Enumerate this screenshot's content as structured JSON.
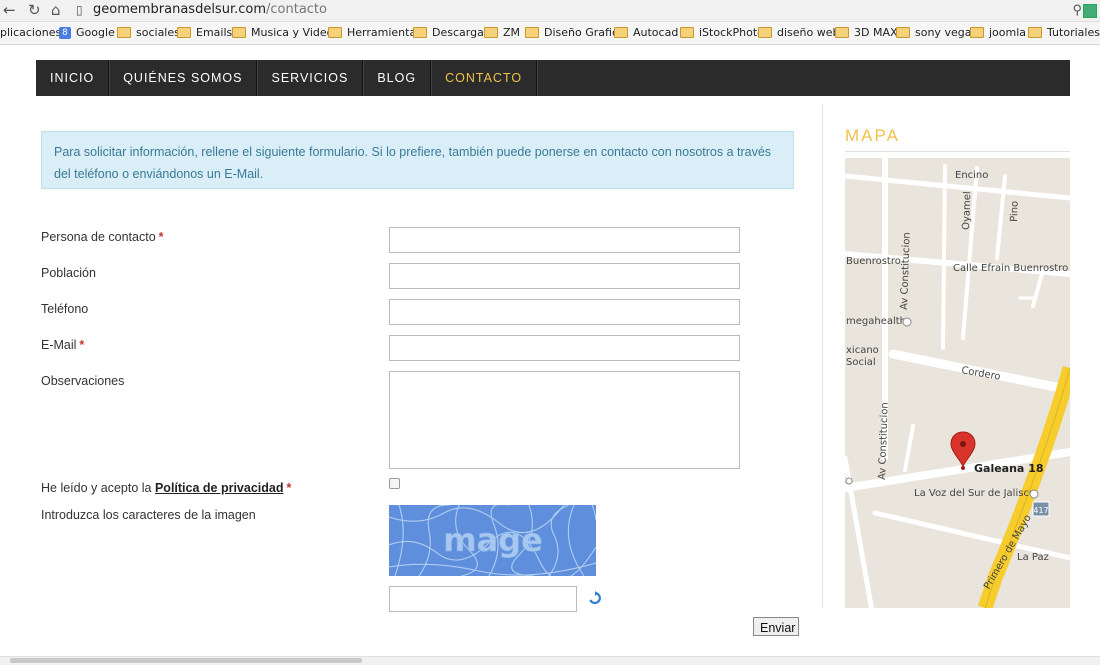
{
  "browser": {
    "url_domain": "geomembranasdelsur.com",
    "url_path": "/contacto",
    "bookmarks": [
      "plicaciones",
      "Google",
      "sociales",
      "Emails",
      "Musica y Videos",
      "Herramientas",
      "Descargas",
      "ZM",
      "Diseño Grafico",
      "Autocad",
      "iStockPhoto",
      "diseño web",
      "3D MAX",
      "sony vegas",
      "joomla",
      "Tutoriales PR"
    ]
  },
  "nav": {
    "items": [
      "INICIO",
      "QUIÉNES SOMOS",
      "SERVICIOS",
      "BLOG",
      "CONTACTO"
    ],
    "active": "CONTACTO"
  },
  "info": {
    "line1": "Para solicitar información, rellene el siguiente formulario. Si lo prefiere, también puede ponerse en contacto con nosotros  a través",
    "line2": "del teléfono o enviándonos un E-Mail."
  },
  "form": {
    "contact_label": "Persona de contacto",
    "population_label": "Población",
    "phone_label": "Teléfono",
    "email_label": "E-Mail",
    "observations_label": "Observaciones",
    "privacy_prefix": "He leído y acepto la ",
    "privacy_link": "Política de privacidad",
    "captcha_label": "Introduzca los caracteres de la imagen",
    "captcha_text": "mage",
    "required_mark": "*",
    "submit_label": "Enviar"
  },
  "sidebar": {
    "title": "MAPA",
    "map_labels": {
      "encino": "Encino",
      "oyamel": "Oyamel",
      "pino": "Pino",
      "buenrostro": "Buenrostro",
      "efrain": "Calle Efrain Buenrostro",
      "constitucion": "Av Constitucion",
      "constitucion2": "Av Constitucion",
      "megahealth": "megahealth",
      "xicano": "xicano",
      "social": "Social",
      "cordero": "Cordero",
      "galeana": "Galeana 18",
      "voz": "La Voz del Sur de Jalisco",
      "route": "417",
      "paz": "La Paz",
      "primero": "Primero de Mayo"
    }
  },
  "colors": {
    "accent": "#f0c24b",
    "nav_bg": "#2b2b2b",
    "info_bg": "#d9eef7",
    "info_text": "#3a7a98",
    "required": "#c0392b",
    "map_road_major": "#f7cd2e",
    "map_pin": "#d9342b"
  }
}
